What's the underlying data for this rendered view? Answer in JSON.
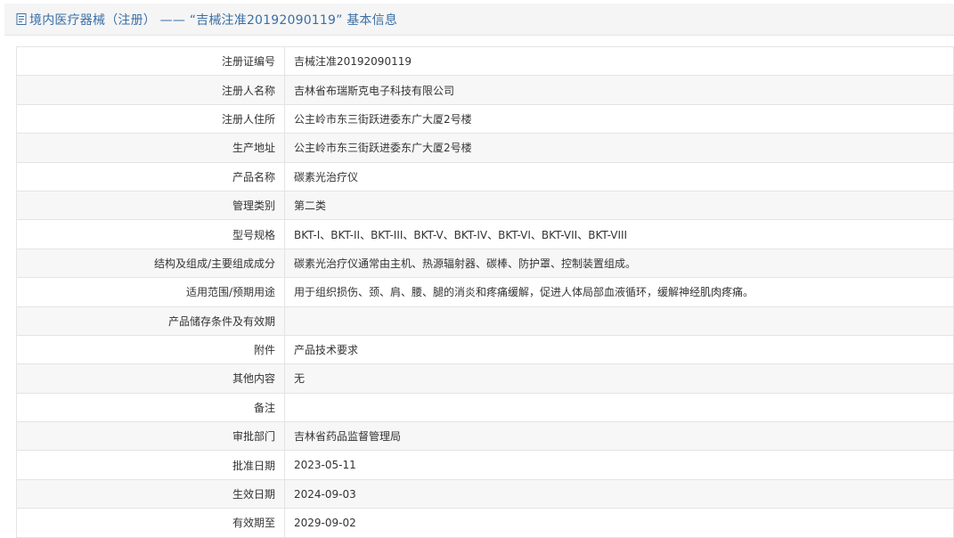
{
  "header": {
    "title": "境内医疗器械（注册） ——  “吉械注准20192090119” 基本信息"
  },
  "rows": [
    {
      "label": "注册证编号",
      "value": "吉械注准20192090119"
    },
    {
      "label": "注册人名称",
      "value": "吉林省布瑞斯克电子科技有限公司"
    },
    {
      "label": "注册人住所",
      "value": "公主岭市东三街跃进委东广大厦2号楼"
    },
    {
      "label": "生产地址",
      "value": "公主岭市东三街跃进委东广大厦2号楼"
    },
    {
      "label": "产品名称",
      "value": "碳素光治疗仪"
    },
    {
      "label": "管理类别",
      "value": "第二类"
    },
    {
      "label": "型号规格",
      "value": "BKT-I、BKT-II、BKT-III、BKT-V、BKT-IV、BKT-VI、BKT-VII、BKT-VIII"
    },
    {
      "label": "结构及组成/主要组成成分",
      "value": "碳素光治疗仪通常由主机、热源辐射器、碳棒、防护罩、控制装置组成。"
    },
    {
      "label": "适用范围/预期用途",
      "value": "用于组织损伤、颈、肩、腰、腿的消炎和疼痛缓解，促进人体局部血液循环，缓解神经肌肉疼痛。"
    },
    {
      "label": "产品储存条件及有效期",
      "value": ""
    },
    {
      "label": "附件",
      "value": "产品技术要求"
    },
    {
      "label": "其他内容",
      "value": "无"
    },
    {
      "label": "备注",
      "value": ""
    },
    {
      "label": "审批部门",
      "value": "吉林省药品监督管理局"
    },
    {
      "label": "批准日期",
      "value": "2023-05-11"
    },
    {
      "label": "生效日期",
      "value": "2024-09-03"
    },
    {
      "label": "有效期至",
      "value": "2029-09-02"
    }
  ]
}
